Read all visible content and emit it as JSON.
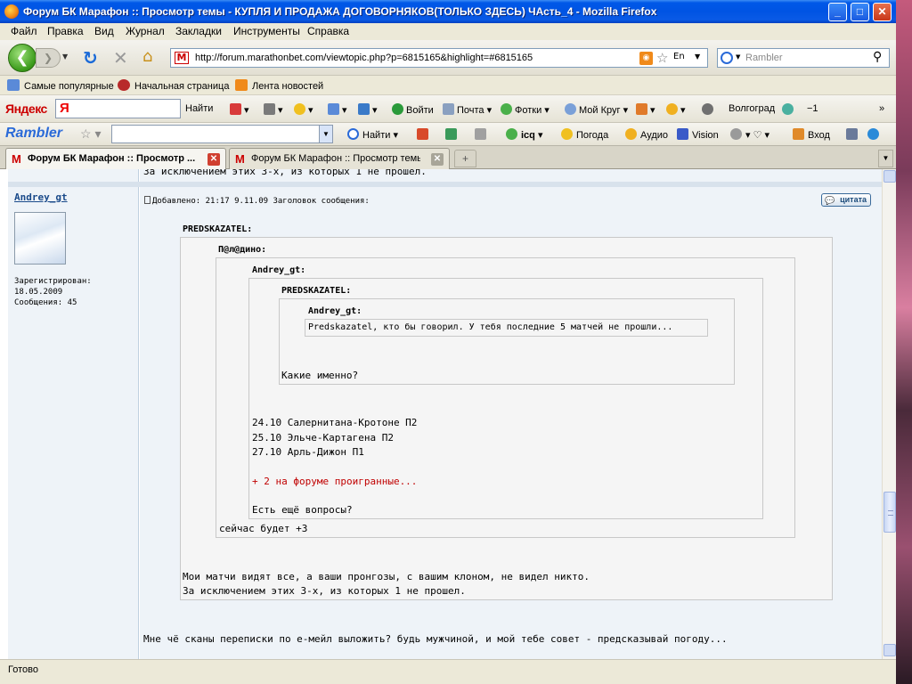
{
  "window": {
    "title": "Форум БК Марафон :: Просмотр темы - КУПЛЯ И ПРОДАЖА ДОГОВОРНЯКОВ(ТОЛЬКО ЗДЕСЬ) ЧАсть_4 - Mozilla Firefox"
  },
  "menu": [
    "Файл",
    "Правка",
    "Вид",
    "Журнал",
    "Закладки",
    "Инструменты",
    "Справка"
  ],
  "nav": {
    "url": "http://forum.marathonbet.com/viewtopic.php?p=6815165&highlight=#6815165",
    "lang": "En",
    "search_placeholder": "Rambler"
  },
  "bookmarks": [
    "Самые популярные",
    "Начальная страница",
    "Лента новостей"
  ],
  "yandex": {
    "logo": "Яндекс",
    "input_value": "Я",
    "find": "Найти",
    "login": "Войти",
    "mail": "Почта",
    "photos": "Фотки",
    "my_circle": "Мой Круг",
    "city": "Волгоград",
    "temp": "−1"
  },
  "rambler": {
    "logo": "Rambler",
    "find": "Найти",
    "icq": "icq",
    "weather": "Погода",
    "audio": "Аудио",
    "vision": "Vision",
    "login": "Вход"
  },
  "tabs": [
    {
      "label": "Форум БК Марафон :: Просмотр ...",
      "active": true
    },
    {
      "label": "Форум БК Марафон :: Просмотр темы...",
      "active": false
    }
  ],
  "post": {
    "prev_text": "За исключением этих 3-х, из которых 1 не прошел.",
    "author": "Andrey_gt",
    "registered_label": "Зарегистрирован:",
    "registered_date": "18.05.2009",
    "messages": "Сообщения: 45",
    "meta": "Добавлено: 21:17 9.11.09   Заголовок сообщения:",
    "quote_button": "цитата",
    "q1_author": "PREDSKAZATEL:",
    "q2_author": "П@л@дино:",
    "q3_author": "Andrey_gt:",
    "q4_author": "PREDSKAZATEL:",
    "q5_author": "Andrey_gt:",
    "q5_text": "Predskazatel, кто бы говорил. У тебя последние 5 матчей не прошли...",
    "q4_text": "Какие именно?",
    "q3_lines": [
      "24.10 Салернитана-Кротоне П2",
      "25.10 Эльче-Картагена П2",
      "27.10 Арль-Дижон П1"
    ],
    "q3_red": "+ 2 на форуме проигранные...",
    "q3_question": "Есть ещё вопросы?",
    "q2_text": "сейчас будет +3",
    "q1_line1": "Мои матчи видят все, а ваши пронгозы, с вашим клоном, не видел никто.",
    "q1_line2": "За исключением этих 3-х, из которых 1 не прошел.",
    "reply": "Мне чё сканы переписки по е-мейл выложить? будь мужчиной, и мой тебе совет - предсказывай погоду..."
  },
  "status": "Готово",
  "colors": {
    "titlebar": "#0054e3",
    "link": "#1a4a8a",
    "red_text": "#c00000"
  }
}
